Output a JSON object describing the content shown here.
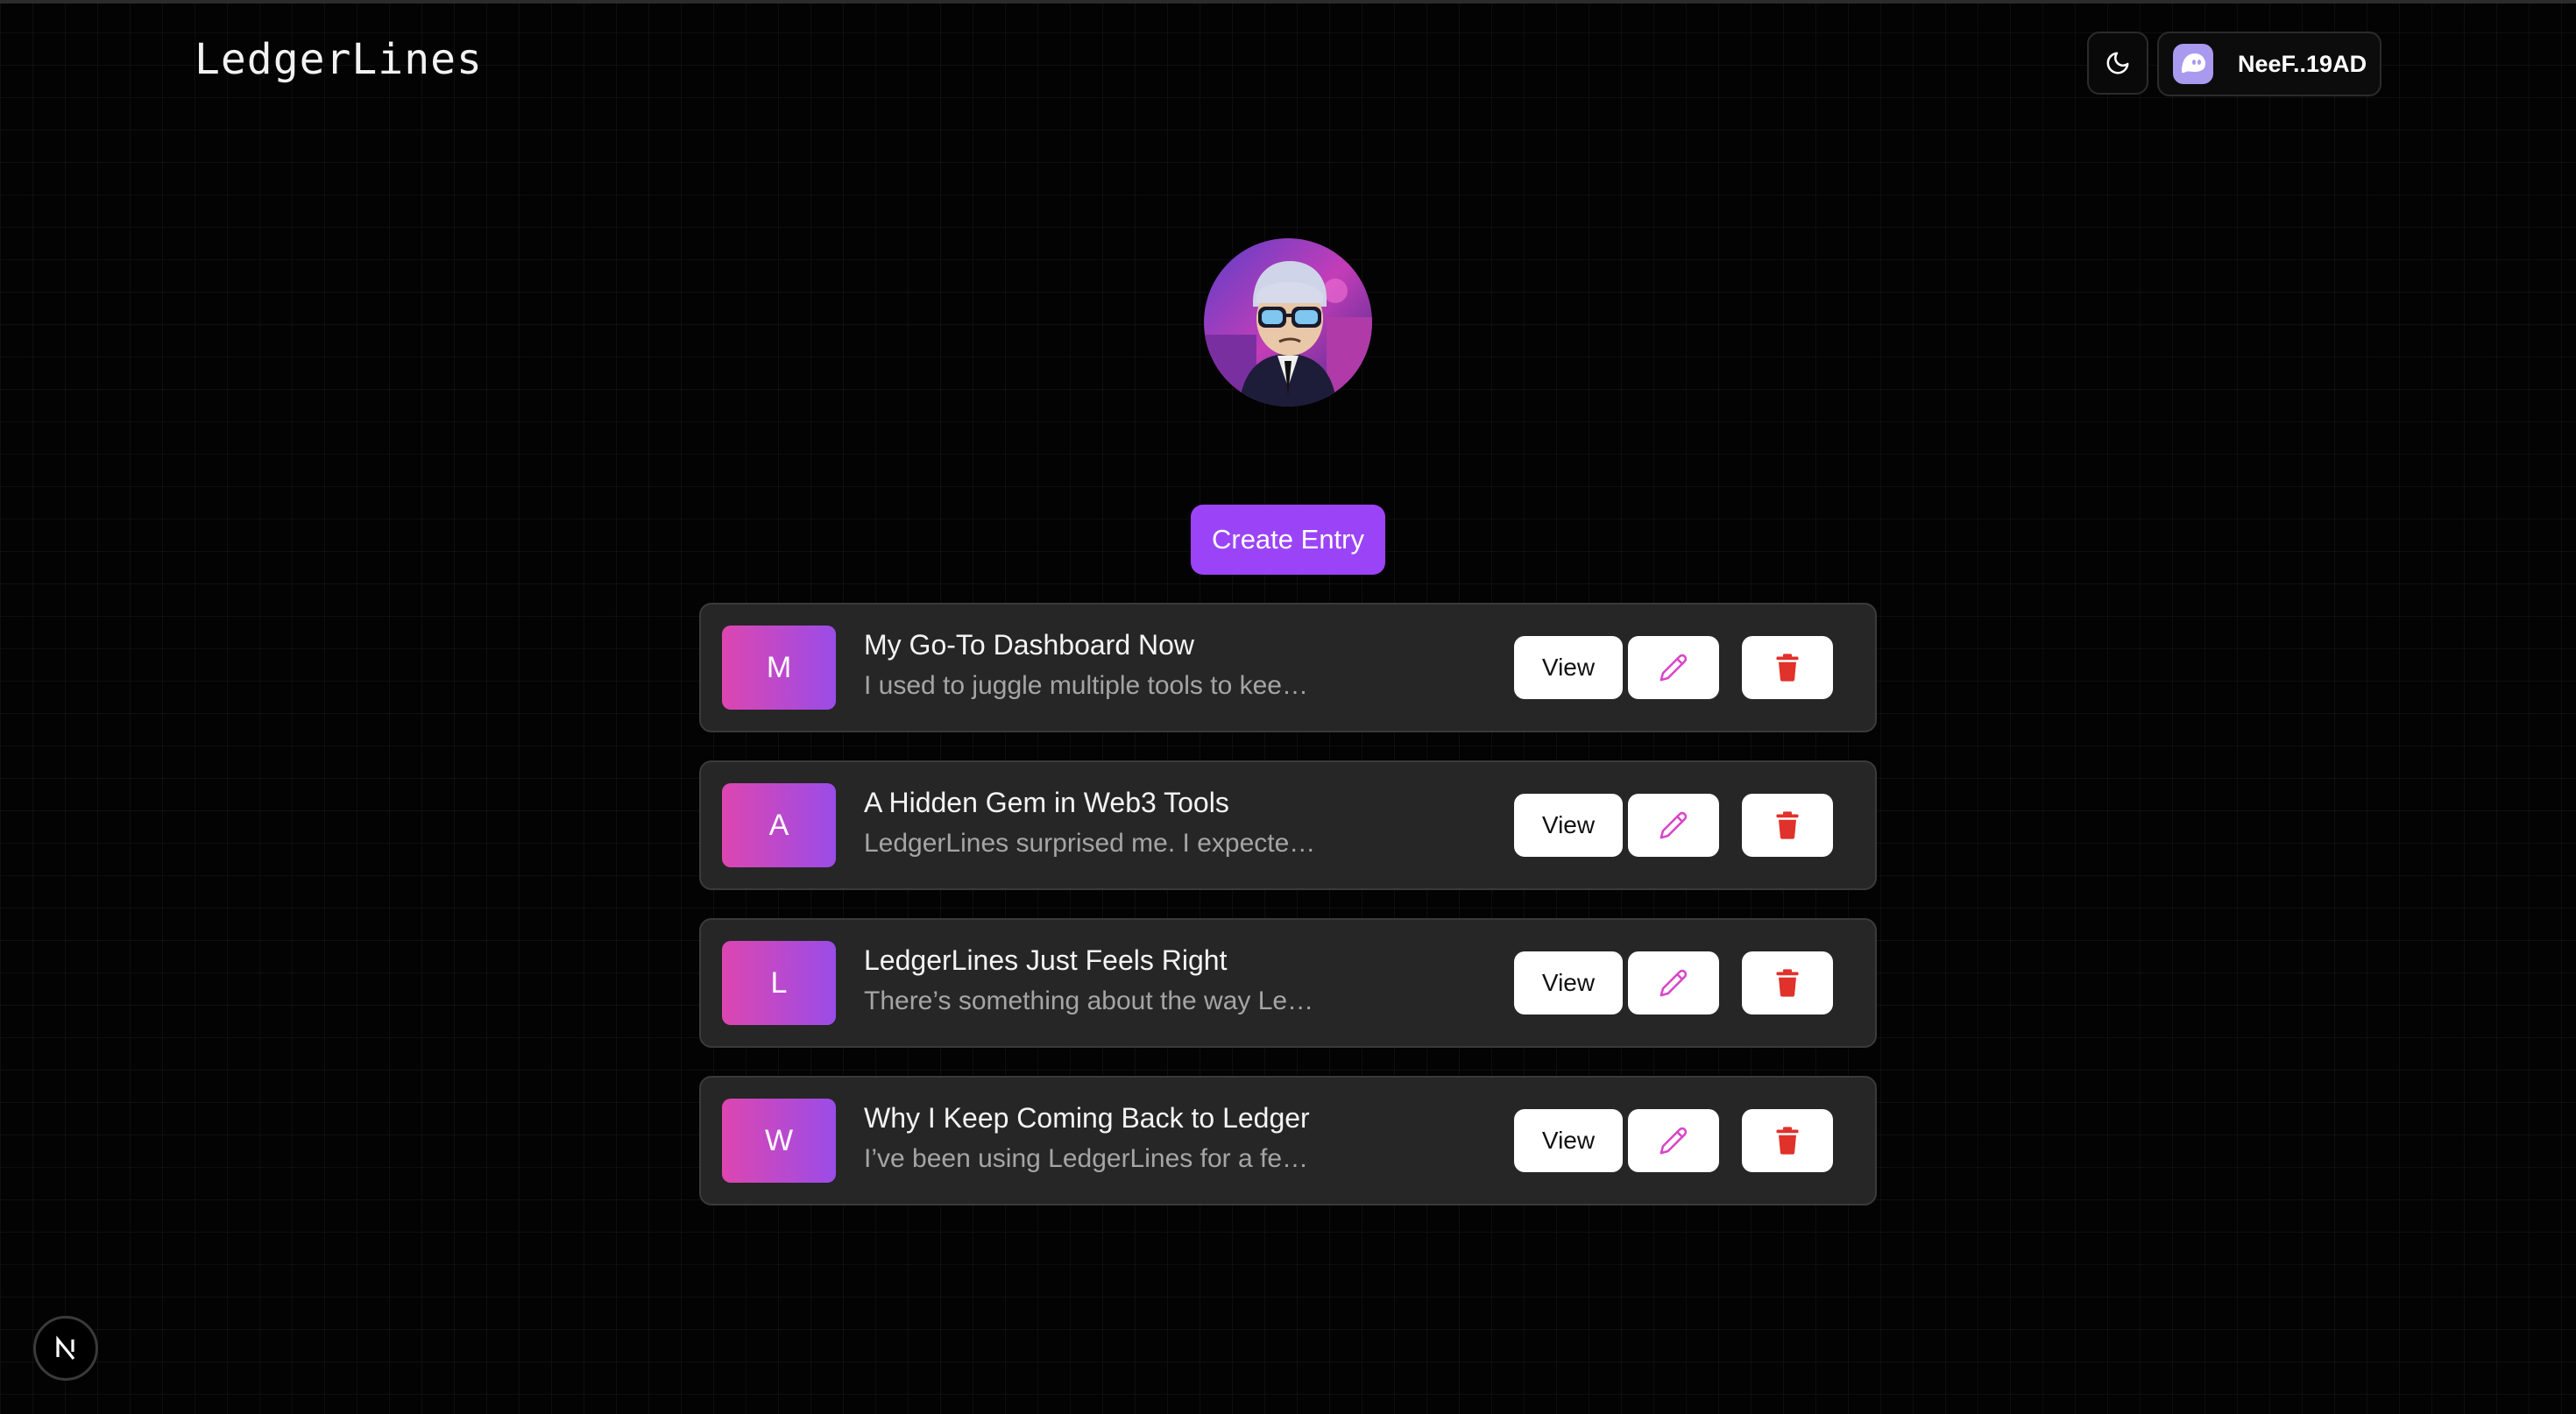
{
  "app": {
    "title": "LedgerLines"
  },
  "header": {
    "theme_toggle_icon": "moon-icon",
    "wallet": {
      "address": "NeeF..19AD",
      "icon": "phantom-ghost-icon"
    }
  },
  "profile": {
    "avatar_icon": "profile-avatar-image"
  },
  "actions": {
    "create_label": "Create Entry"
  },
  "entries": [
    {
      "letter": "M",
      "title": "My Go-To Dashboard Now",
      "excerpt": "I used to juggle multiple tools to keep track of my…",
      "view_label": "View"
    },
    {
      "letter": "A",
      "title": "A Hidden Gem in Web3 Tools",
      "excerpt": "LedgerLines surprised me. I expected just another…",
      "view_label": "View"
    },
    {
      "letter": "L",
      "title": "LedgerLines Just Feels Right",
      "excerpt": "There’s something about the way LedgerLines is…",
      "view_label": "View"
    },
    {
      "letter": "W",
      "title": "Why I Keep Coming Back to Ledger",
      "excerpt": "I’ve been using LedgerLines for a few weeks now,…",
      "view_label": "View"
    }
  ],
  "footer": {
    "badge_letter": "N",
    "badge_icon": "nextjs-icon"
  },
  "colors": {
    "background": "#030303",
    "accent": "#9b44f7",
    "card": "#262626",
    "gradient_start": "#dd46b0",
    "gradient_end": "#9a4ce8",
    "delete": "#e0312b",
    "edit": "#d946c8"
  }
}
